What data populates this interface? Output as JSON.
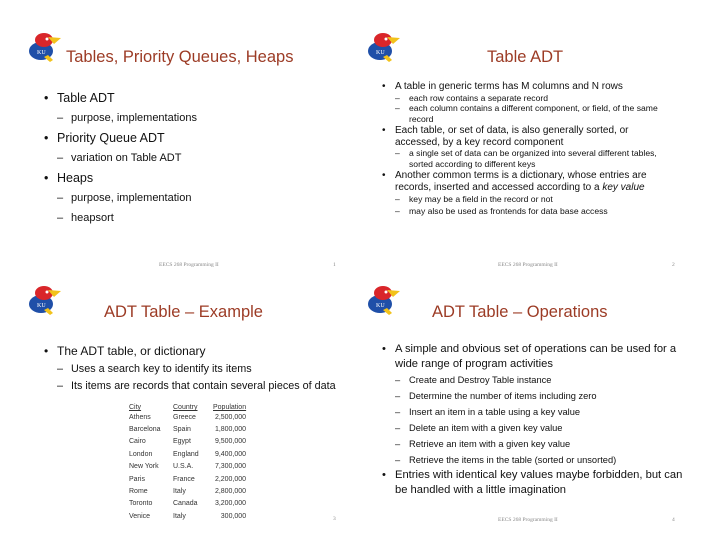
{
  "footer_text": "EECS 268 Programming II",
  "logo_label": "KU",
  "colors": {
    "title": "#9c3b25",
    "logo_blue": "#1f4fa8",
    "logo_red": "#d9262a",
    "logo_yellow": "#f2c21b"
  },
  "slides": [
    {
      "number": "1",
      "title": "Tables, Priority Queues, Heaps",
      "bullets": [
        {
          "text": "Table ADT",
          "subs": [
            "purpose, implementations"
          ]
        },
        {
          "text": "Priority Queue ADT",
          "subs": [
            "variation on Table ADT"
          ]
        },
        {
          "text": "Heaps",
          "subs": [
            "purpose, implementation",
            "heapsort"
          ]
        }
      ]
    },
    {
      "number": "2",
      "title": "Table ADT",
      "bullets": [
        {
          "text": "A table in generic terms has M columns and N rows",
          "subs": [
            "each row contains a separate record",
            "each column contains a different component, or field, of the same record"
          ]
        },
        {
          "text": "Each table, or set of data, is also generally sorted, or accessed, by a key record component",
          "subs": [
            "a single set of data can be organized into several different tables, sorted according to different keys"
          ]
        },
        {
          "text": "Another common terms is a dictionary, whose entries are records, inserted and accessed according to a ",
          "italic": "key value",
          "subs": [
            "key may be a field in the record or not",
            "may also be used as frontends for data base access"
          ]
        }
      ]
    },
    {
      "number": "3",
      "title": "ADT Table – Example",
      "bullets": [
        {
          "text": "The ADT table, or dictionary",
          "subs": [
            "Uses a search key to identify its items",
            "Its items are records that contain several pieces of data"
          ]
        }
      ],
      "table": {
        "headers": [
          "City",
          "Country",
          "Population"
        ],
        "rows": [
          [
            "Athens",
            "Greece",
            "2,500,000"
          ],
          [
            "Barcelona",
            "Spain",
            "1,800,000"
          ],
          [
            "Cairo",
            "Egypt",
            "9,500,000"
          ],
          [
            "London",
            "England",
            "9,400,000"
          ],
          [
            "New York",
            "U.S.A.",
            "7,300,000"
          ],
          [
            "Paris",
            "France",
            "2,200,000"
          ],
          [
            "Rome",
            "Italy",
            "2,800,000"
          ],
          [
            "Toronto",
            "Canada",
            "3,200,000"
          ],
          [
            "Venice",
            "Italy",
            "300,000"
          ]
        ]
      }
    },
    {
      "number": "4",
      "title": "ADT Table – Operations",
      "bullets": [
        {
          "text": "A simple and obvious set of operations can be used for a wide range of program activities",
          "subs": [
            "Create and Destroy Table instance",
            "Determine the number of items including zero",
            "Insert an item in a table using a key value",
            "Delete an item with a given key value",
            "Retrieve an item with a given key value",
            "Retrieve the items in the table (sorted or unsorted)"
          ]
        },
        {
          "text": "Entries with identical key values maybe forbidden, but can be handled with a little imagination",
          "subs": []
        }
      ]
    }
  ]
}
